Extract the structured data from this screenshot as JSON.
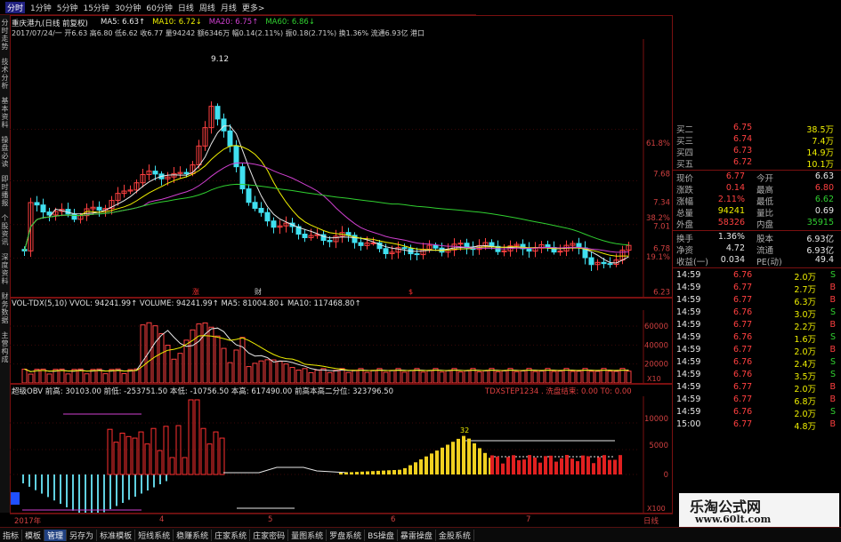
{
  "periods": [
    "分时",
    "1分钟",
    "5分钟",
    "15分钟",
    "30分钟",
    "60分钟",
    "日线",
    "周线",
    "月线",
    "更多>"
  ],
  "active_period_index": 0,
  "left_tabs": [
    "分时走势",
    "技术分析",
    "基本资料",
    "操盘必读",
    "即时播报",
    "个股资讯",
    "深度资料",
    "财务数据",
    "主营构成"
  ],
  "main_panel": {
    "title_line": "重庆港九(日线 前复权)",
    "ma_labels": [
      {
        "text": "MA5: 6.63↑",
        "color": "#e8e8e8"
      },
      {
        "text": "MA10: 6.72↓",
        "color": "#f0f000"
      },
      {
        "text": "MA20: 6.75↑",
        "color": "#d040d0"
      },
      {
        "text": "MA60: 6.86↓",
        "color": "#30d030"
      }
    ],
    "info_line": "2017/07/24/一 开6.63 高6.80 低6.62 收6.77 量94242 额6346万 幅0.14(2.11%) 振0.18(2.71%) 换1.36% 流通6.93亿 港口",
    "high_label": "9.12",
    "price_axis": [
      "7.68",
      "7.34",
      "7.01",
      "6.78",
      "6.23"
    ],
    "pct_axis": [
      "61.8%",
      "38.2%",
      "19.1%"
    ],
    "event_markers": [
      "涨",
      "财",
      "$"
    ]
  },
  "volume_panel": {
    "header": "VOL-TDX(5,10) VVOL: 94241.99↑ VOLUME: 94241.99↑ MA5: 81004.80↓ MA10: 117468.80↑",
    "axis": [
      "60000",
      "40000",
      "20000"
    ],
    "unit": "X10"
  },
  "obv_panel": {
    "header": "超级OBV   前高: 30103.00 前低: -253751.50 本低: -10756.50 本高: 617490.00   前高本高二分位: 323796.50",
    "right_header": "TDXSTEP1234 . 洗盘结束: 0.00 T0: 0.00",
    "axis": [
      "10000",
      "5000",
      "0"
    ],
    "unit": "X100",
    "peak_label": "32"
  },
  "date_axis": {
    "labels": [
      "2017年",
      "4",
      "5",
      "6",
      "7",
      "日线"
    ]
  },
  "quote": {
    "bids_top": [
      {
        "label": "买二",
        "price": "6.75",
        "vol": "38.5万"
      },
      {
        "label": "买三",
        "price": "6.74",
        "vol": "7.4万"
      },
      {
        "label": "买四",
        "price": "6.73",
        "vol": "14.9万"
      },
      {
        "label": "买五",
        "price": "6.72",
        "vol": "10.1万"
      }
    ],
    "stats": [
      {
        "l1": "现价",
        "v1": "6.77",
        "c1": "red",
        "l2": "今开",
        "v2": "6.63",
        "c2": "white"
      },
      {
        "l1": "涨跌",
        "v1": "0.14",
        "c1": "red",
        "l2": "最高",
        "v2": "6.80",
        "c2": "red"
      },
      {
        "l1": "涨幅",
        "v1": "2.11%",
        "c1": "red",
        "l2": "最低",
        "v2": "6.62",
        "c2": "green"
      },
      {
        "l1": "总量",
        "v1": "94241",
        "c1": "yellow",
        "l2": "量比",
        "v2": "0.69",
        "c2": "white"
      },
      {
        "l1": "外盘",
        "v1": "58326",
        "c1": "red",
        "l2": "内盘",
        "v2": "35915",
        "c2": "green"
      },
      {
        "l1": "换手",
        "v1": "1.36%",
        "c1": "white",
        "l2": "股本",
        "v2": "6.93亿",
        "c2": "white"
      },
      {
        "l1": "净资",
        "v1": "4.72",
        "c1": "white",
        "l2": "流通",
        "v2": "6.93亿",
        "c2": "white"
      },
      {
        "l1": "收益(一)",
        "v1": "0.034",
        "c1": "white",
        "l2": "PE(动)",
        "v2": "49.4",
        "c2": "white"
      }
    ],
    "ticks": [
      {
        "time": "14:59",
        "price": "6.76",
        "vol": "2.0万",
        "side": "S"
      },
      {
        "time": "14:59",
        "price": "6.77",
        "vol": "2.7万",
        "side": "B"
      },
      {
        "time": "14:59",
        "price": "6.77",
        "vol": "6.3万",
        "side": "B"
      },
      {
        "time": "14:59",
        "price": "6.76",
        "vol": "3.0万",
        "side": "S"
      },
      {
        "time": "14:59",
        "price": "6.77",
        "vol": "2.2万",
        "side": "B"
      },
      {
        "time": "14:59",
        "price": "6.76",
        "vol": "1.6万",
        "side": "S"
      },
      {
        "time": "14:59",
        "price": "6.77",
        "vol": "2.0万",
        "side": "B"
      },
      {
        "time": "14:59",
        "price": "6.76",
        "vol": "2.4万",
        "side": "S"
      },
      {
        "time": "14:59",
        "price": "6.76",
        "vol": "3.5万",
        "side": "S"
      },
      {
        "time": "14:59",
        "price": "6.77",
        "vol": "2.0万",
        "side": "B"
      },
      {
        "time": "14:59",
        "price": "6.77",
        "vol": "6.8万",
        "side": "B"
      },
      {
        "time": "14:59",
        "price": "6.76",
        "vol": "2.0万",
        "side": "S"
      },
      {
        "time": "15:00",
        "price": "6.77",
        "vol": "4.8万",
        "side": "B"
      }
    ]
  },
  "bottom_tabs": [
    "指标",
    "模板",
    "管理",
    "另存为",
    "标准模板",
    "短线系统",
    "稳赚系统",
    "庄家系统",
    "庄家密码",
    "量图系统",
    "罗盘系统",
    "BS操盘",
    "暴雷操盘",
    "金股系统"
  ],
  "active_bottom_tab": 2,
  "watermark": {
    "title": "乐淘公式网",
    "url": "www.60lt.com"
  },
  "colors": {
    "up": "#ff4040",
    "down": "#40e0f0",
    "grid": "#7a1010",
    "ma5": "#e8e8e8",
    "ma10": "#f0f000",
    "ma20": "#d040d0",
    "ma60": "#30d030"
  }
}
